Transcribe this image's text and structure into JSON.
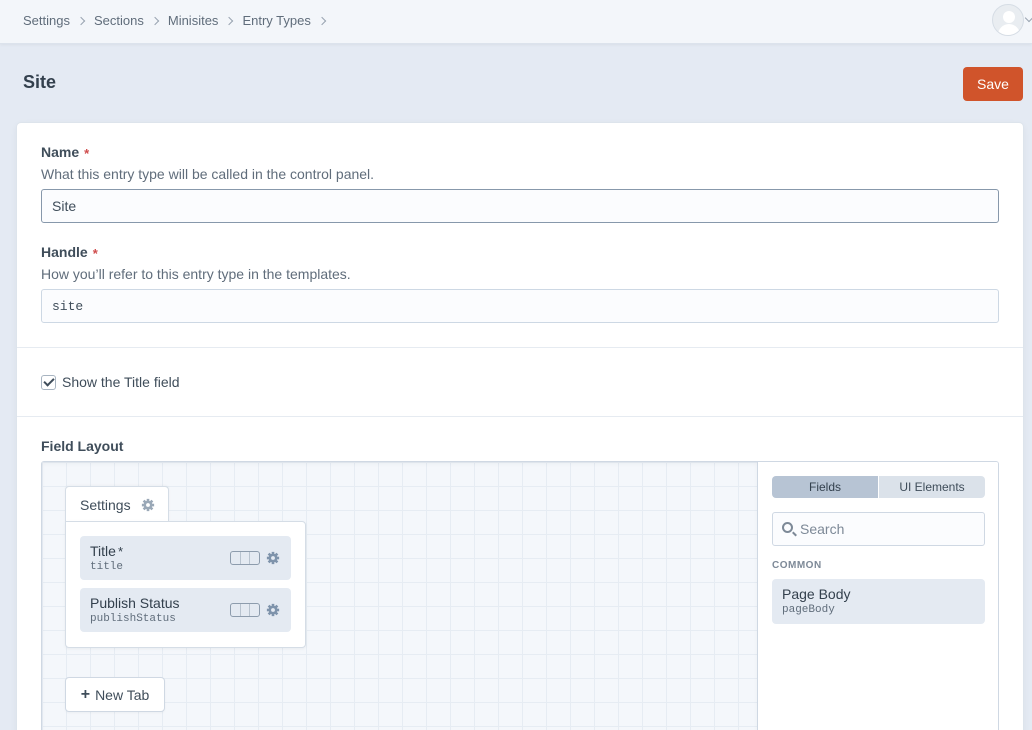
{
  "breadcrumbs": [
    "Settings",
    "Sections",
    "Minisites",
    "Entry Types"
  ],
  "page": {
    "title": "Site",
    "save_label": "Save"
  },
  "name_field": {
    "label": "Name",
    "required_mark": "*",
    "instructions": "What this entry type will be called in the control panel.",
    "value": "Site"
  },
  "handle_field": {
    "label": "Handle",
    "required_mark": "*",
    "instructions": "How you’ll refer to this entry type in the templates.",
    "value": "site"
  },
  "show_title": {
    "label": "Show the Title field",
    "checked": true
  },
  "field_layout": {
    "label": "Field Layout",
    "tab": {
      "name": "Settings"
    },
    "fields": [
      {
        "name": "Title",
        "required_mark": "*",
        "handle": "title"
      },
      {
        "name": "Publish Status",
        "handle": "publishStatus"
      }
    ],
    "new_tab_label": "New Tab",
    "library": {
      "toggle": [
        "Fields",
        "UI Elements"
      ],
      "active_toggle": "Fields",
      "search_placeholder": "Search",
      "group": "COMMON",
      "available": [
        {
          "name": "Page Body",
          "handle": "pageBody"
        }
      ]
    }
  },
  "colors": {
    "accent": "#d0542b",
    "background": "#e4eaf3",
    "required": "#cf4b4b"
  }
}
